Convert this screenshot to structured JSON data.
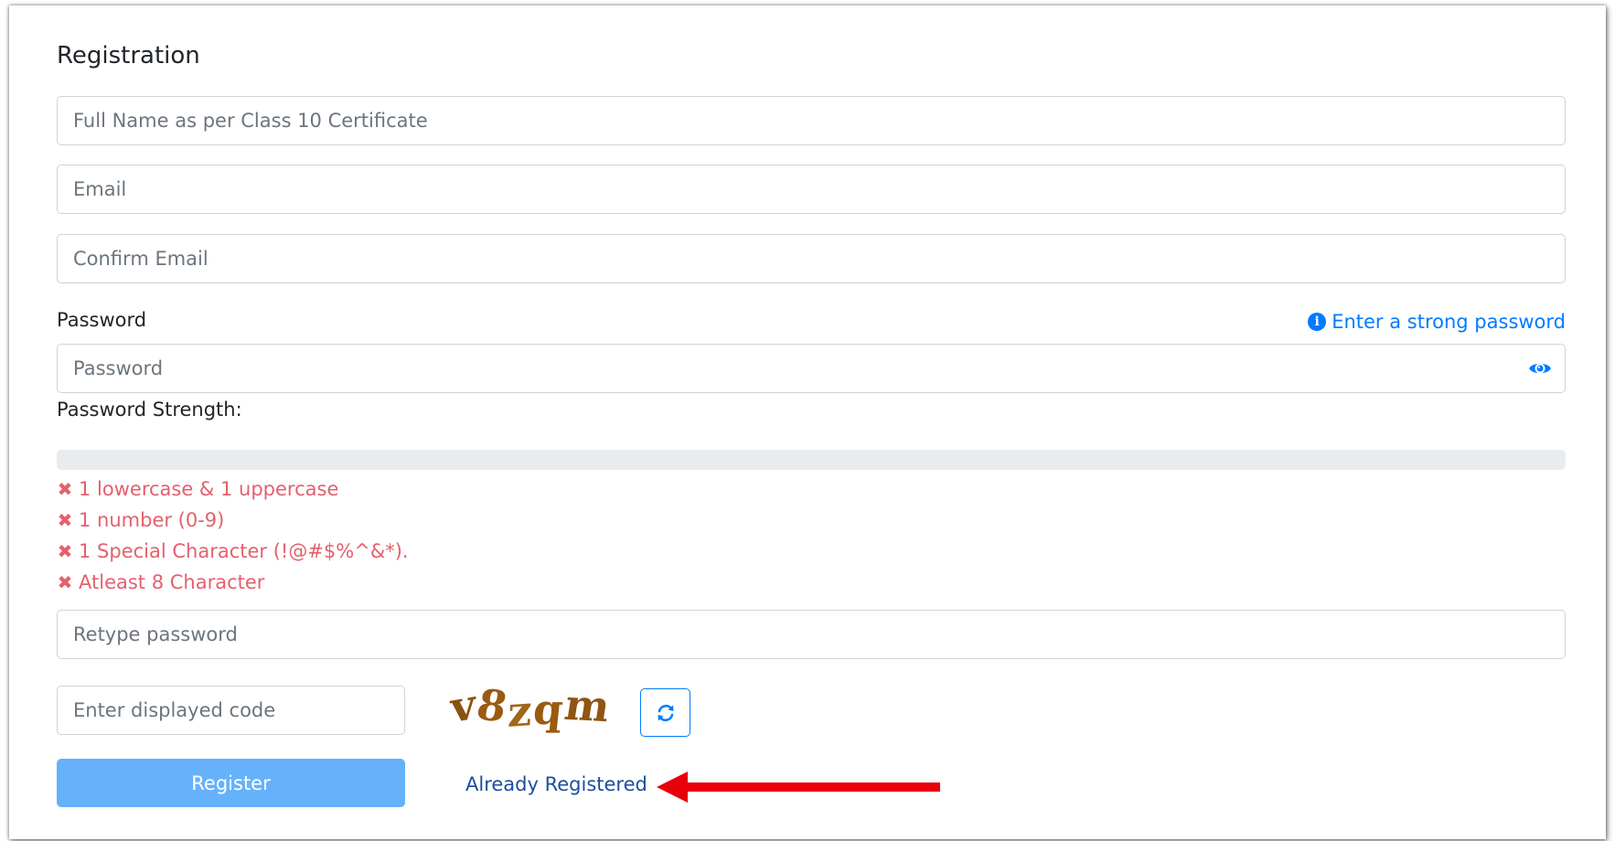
{
  "form": {
    "title": "Registration",
    "full_name_placeholder": "Full Name as per Class 10 Certificate",
    "email_placeholder": "Email",
    "confirm_email_placeholder": "Confirm Email",
    "password_label": "Password",
    "password_hint": "Enter a strong password",
    "password_placeholder": "Password",
    "strength_label": "Password Strength:",
    "strength_level": 0,
    "rules": [
      "1 lowercase & 1 uppercase",
      "1 number (0-9)",
      "1 Special Character (!@#$%^&*).",
      "Atleast 8 Character"
    ],
    "retype_placeholder": "Retype password",
    "captcha_placeholder": "Enter displayed code",
    "captcha_chars": [
      "v",
      "8",
      "z",
      "q",
      "m"
    ],
    "register_label": "Register",
    "already_registered_label": "Already Registered"
  },
  "icons": {
    "info": "info-circle-icon",
    "eye": "eye-icon",
    "rule_fail": "times-icon",
    "refresh": "refresh-icon",
    "arrow": "red-arrow-annotation"
  },
  "colors": {
    "primary": "#007bff",
    "error": "#e4606d",
    "register_button": "#65b2fb",
    "annotation_arrow": "#e8000b"
  }
}
